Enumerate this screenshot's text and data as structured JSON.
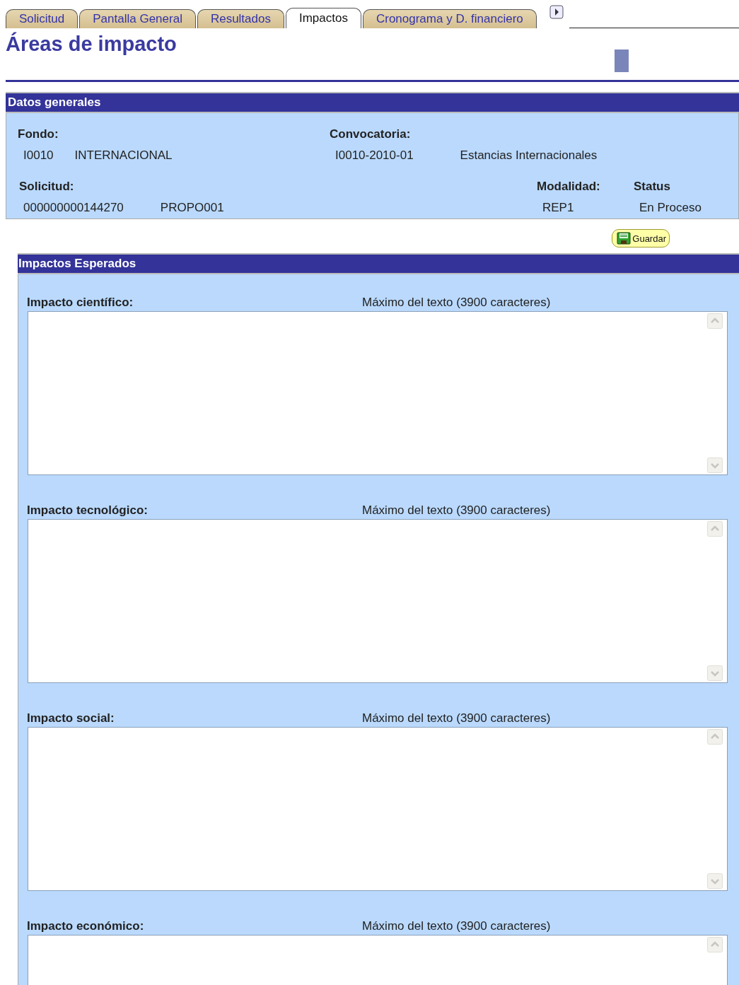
{
  "tabs": [
    {
      "label": "Solicitud",
      "selected": false
    },
    {
      "label": "Pantalla General",
      "selected": false
    },
    {
      "label": "Resultados",
      "selected": false
    },
    {
      "label": "Impactos",
      "selected": true
    },
    {
      "label": "Cronograma y D. financiero",
      "selected": false
    }
  ],
  "page_title": "Áreas de impacto",
  "general": {
    "title": "Datos generales",
    "fondo": {
      "label": "Fondo:",
      "code": "I0010",
      "name": "INTERNACIONAL"
    },
    "convocatoria": {
      "label": "Convocatoria:",
      "code": "I0010-2010-01",
      "name": "Estancias Internacionales"
    },
    "solicitud": {
      "label": "Solicitud:",
      "number": "000000000144270",
      "code": "PROPO001"
    },
    "modalidad": {
      "label": "Modalidad:",
      "value": "REP1"
    },
    "status": {
      "label": "Status",
      "value": "En Proceso"
    }
  },
  "save_button": "Guardar",
  "impacts": {
    "title": "Impactos Esperados",
    "fields": [
      {
        "label": "Impacto científico:",
        "hint": "Máximo del texto (3900 caracteres)",
        "cut_off": false
      },
      {
        "label": "Impacto tecnológico:",
        "hint": "Máximo del texto (3900 caracteres)",
        "cut_off": false
      },
      {
        "label": "Impacto social:",
        "hint": "Máximo del texto (3900 caracteres)",
        "cut_off": false
      },
      {
        "label": "Impacto económico:",
        "hint": "Máximo del texto (3900 caracteres)",
        "cut_off": true
      }
    ]
  }
}
